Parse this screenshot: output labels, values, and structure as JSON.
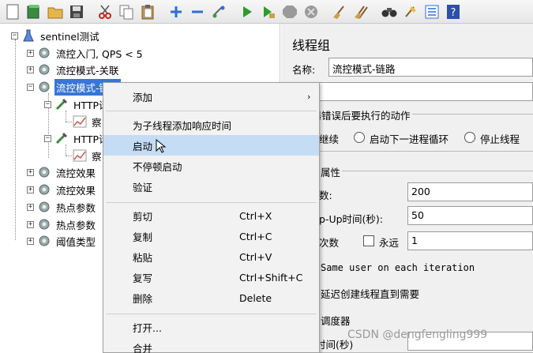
{
  "toolbar": {
    "icons": [
      "new-icon",
      "templates-icon",
      "open-icon",
      "save-icon",
      "cut-icon",
      "copy-icon",
      "paste-icon",
      "expand-icon",
      "collapse-icon",
      "toggle-icon",
      "start-icon",
      "start-no-pause-icon",
      "stop-icon",
      "shutdown-icon",
      "clear-icon",
      "clear-all-icon",
      "search-icon",
      "reset-search-icon",
      "function-helper-icon",
      "help-icon"
    ]
  },
  "tree": {
    "root": "sentinel测试",
    "items": [
      {
        "label": "流控入门, QPS < 5"
      },
      {
        "label": "流控模式-关联"
      },
      {
        "label": "流控模式-链路"
      },
      {
        "label": "HTTP请"
      },
      {
        "label": "察"
      },
      {
        "label": "HTTP请"
      },
      {
        "label": "察"
      },
      {
        "label": "流控效果"
      },
      {
        "label": "流控效果"
      },
      {
        "label": "热点参数"
      },
      {
        "label": "热点参数"
      },
      {
        "label": "阈值类型"
      }
    ]
  },
  "panel": {
    "title": "线程组",
    "name_label": "名称:",
    "name_value": "流控模式-链路",
    "on_error_label": "样器错误后要执行的动作",
    "radio_continue": "继续",
    "radio_next_loop": "启动下一进程循环",
    "radio_stop_thread": "停止线程",
    "props_label": "属性",
    "threads_label": "数:",
    "threads_value": "200",
    "rampup_label": "p-Up时间(秒):",
    "rampup_value": "50",
    "loops_label": "次数",
    "forever_label": "永远",
    "loops_value": "1",
    "same_user_label": "Same user on each iteration",
    "delay_label": "延迟创建线程直到需要",
    "scheduler_label": "调度器",
    "duration_label": "时间(秒)"
  },
  "menu": {
    "items": [
      {
        "label": "添加",
        "shortcut": "",
        "submenu": true
      },
      {
        "label": "为子线程添加响应时间",
        "shortcut": ""
      },
      {
        "label": "启动",
        "shortcut": ""
      },
      {
        "label": "不停顿启动",
        "shortcut": ""
      },
      {
        "label": "验证",
        "shortcut": ""
      },
      {
        "label": "剪切",
        "shortcut": "Ctrl+X"
      },
      {
        "label": "复制",
        "shortcut": "Ctrl+C"
      },
      {
        "label": "粘贴",
        "shortcut": "Ctrl+V"
      },
      {
        "label": "复写",
        "shortcut": "Ctrl+Shift+C"
      },
      {
        "label": "删除",
        "shortcut": "Delete"
      },
      {
        "label": "打开...",
        "shortcut": ""
      },
      {
        "label": "合并",
        "shortcut": ""
      }
    ],
    "submenu_arrow": "›"
  },
  "watermark": "CSDN @dengfengling999"
}
